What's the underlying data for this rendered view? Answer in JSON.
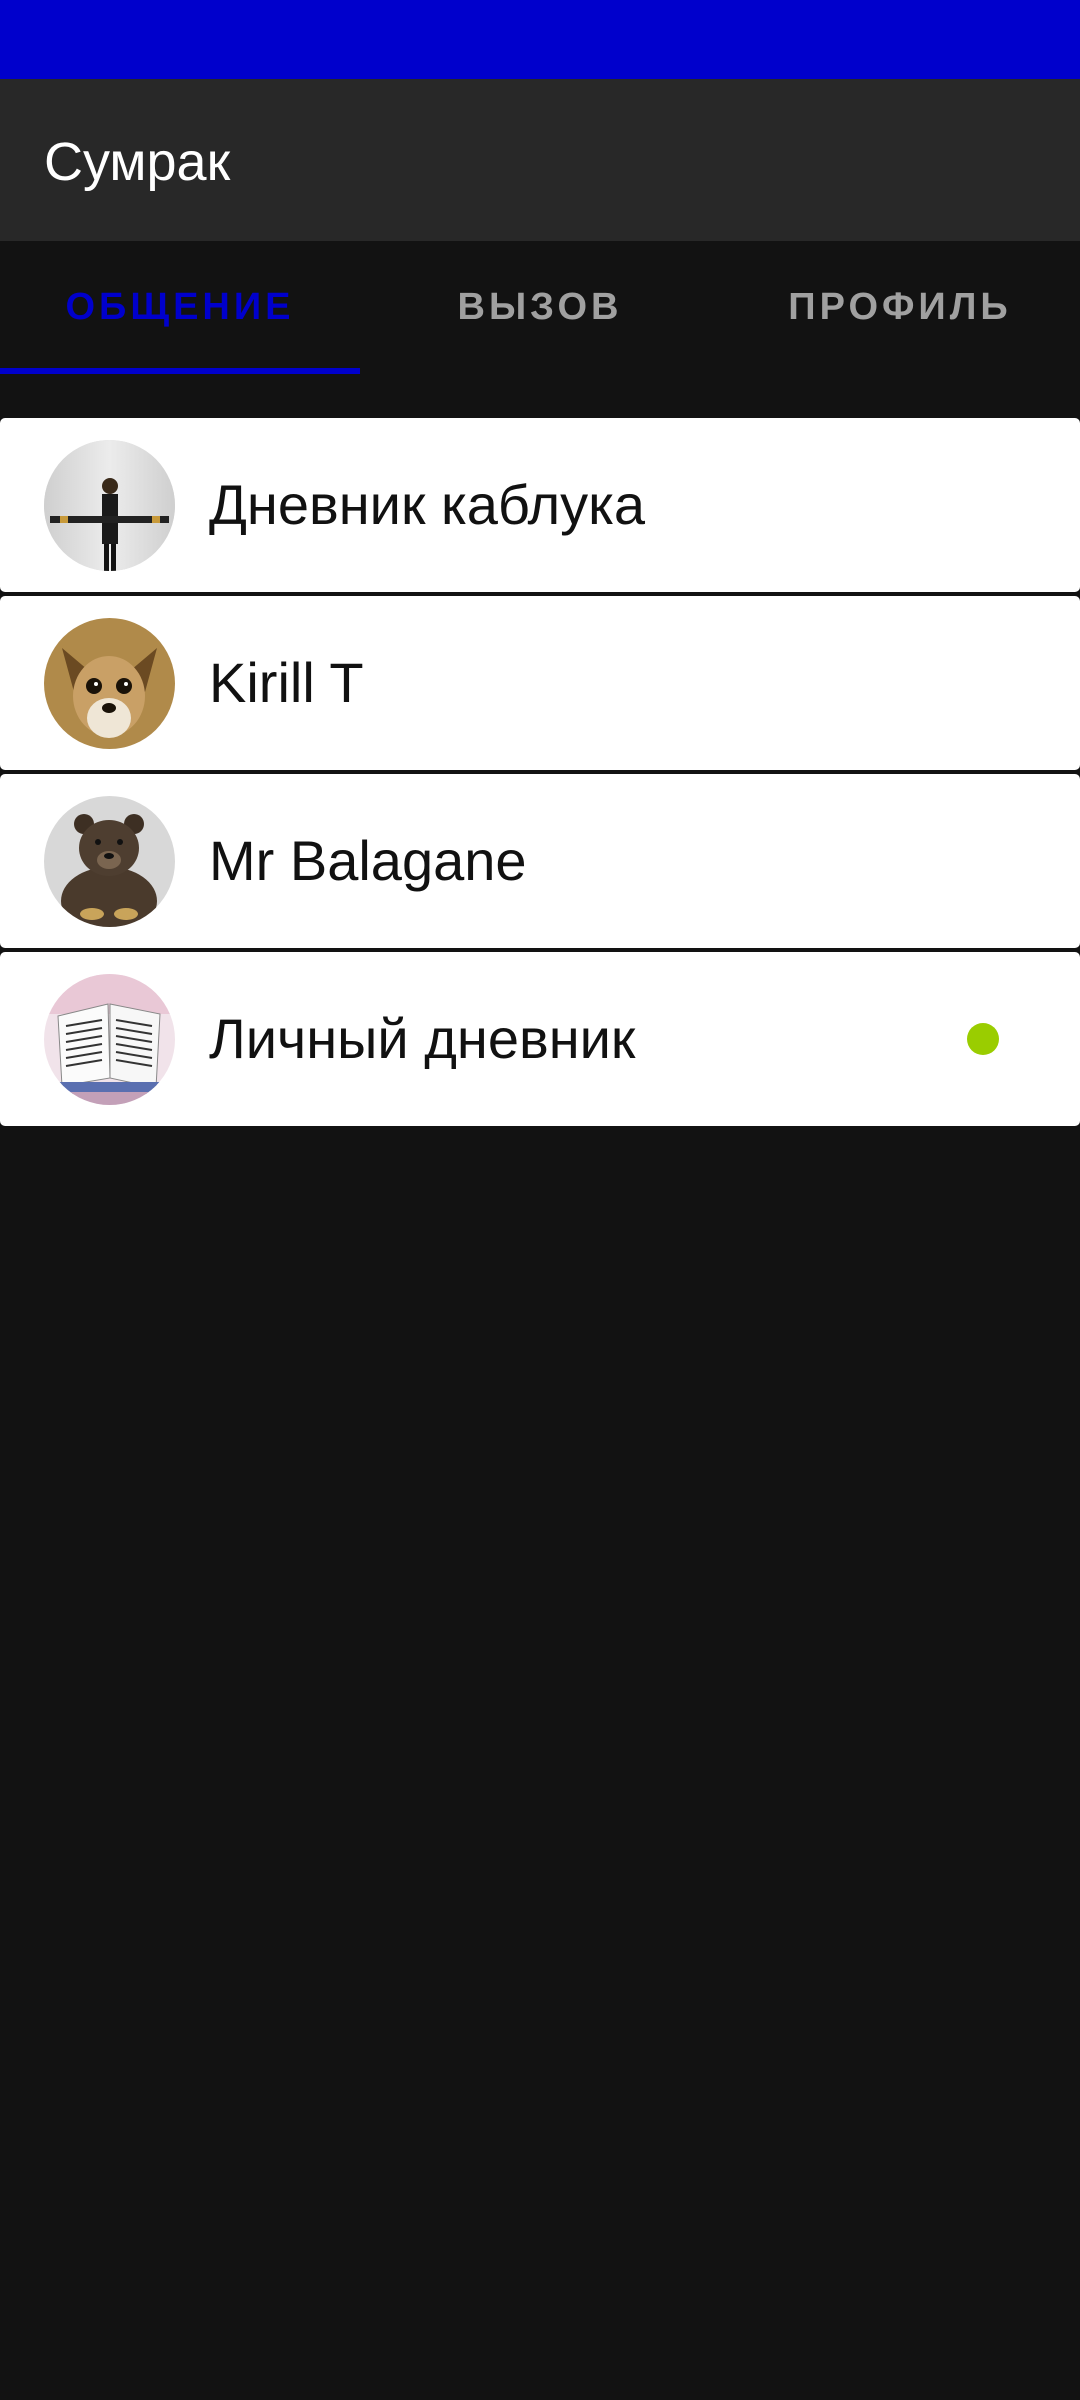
{
  "app": {
    "title": "Сумрак"
  },
  "tabs": [
    {
      "label": "ОБЩЕНИЕ",
      "active": true
    },
    {
      "label": "ВЫЗОВ",
      "active": false
    },
    {
      "label": "ПРОФИЛЬ",
      "active": false
    }
  ],
  "chats": [
    {
      "name": "Дневник каблука",
      "avatar": "figure-avatar",
      "unread": false
    },
    {
      "name": "Kirill T",
      "avatar": "chihuahua-avatar",
      "unread": false
    },
    {
      "name": "Mr Balagane",
      "avatar": "bear-avatar",
      "unread": false
    },
    {
      "name": "Личный дневник",
      "avatar": "diary-avatar",
      "unread": true
    }
  ],
  "colors": {
    "accent": "#0000cc",
    "status_bar": "#0000cc",
    "app_bar": "#282828",
    "background": "#121212",
    "unread_dot": "#9acd00"
  }
}
